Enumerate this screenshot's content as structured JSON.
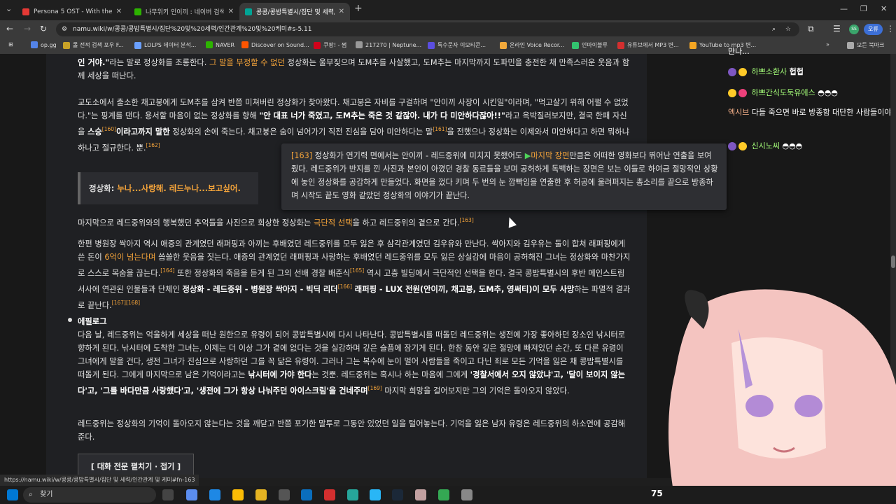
{
  "tabs": [
    {
      "label": "Persona 5 OST - With the",
      "color": "#e53935",
      "active": false
    },
    {
      "label": "나무위키 인이끼 : 네이버 검색",
      "color": "#2db400",
      "active": false
    },
    {
      "label": "콩콩/콩밥특별시/집단 및 세력/",
      "color": "#00a495",
      "active": true
    }
  ],
  "address": {
    "url": "namu.wiki/w/콩콩/콩밥특별시/집단%20및%20세력/인간관계%20및%20케미#s-5.11"
  },
  "profile": {
    "label": "오류"
  },
  "bookmarks": [
    {
      "label": "op.gg",
      "color": "#5383e8"
    },
    {
      "label": "롤 전적 검색 포우 F...",
      "color": "#c9a227"
    },
    {
      "label": "LOLPS 데이터 분석...",
      "color": "#6aa0ff"
    },
    {
      "label": "NAVER",
      "color": "#2db400"
    },
    {
      "label": "Discover on Sound...",
      "color": "#ff5500"
    },
    {
      "label": "쿠팡! - 쩜",
      "color": "#d0021b"
    },
    {
      "label": "217270 | Neptune...",
      "color": "#999999"
    },
    {
      "label": "특수문자 이모티콘...",
      "color": "#5b4ee0"
    },
    {
      "label": "온라인 Voice Recor...",
      "color": "#f2a93b"
    },
    {
      "label": "인마이블루",
      "color": "#33c36f"
    },
    {
      "label": "유튜브에서 MP3 변...",
      "color": "#d32f2f"
    },
    {
      "label": "YouTube to mp3 변...",
      "color": "#f5a623"
    },
    {
      "label": "모든 북마크",
      "color": "#aaaaaa"
    }
  ],
  "article": {
    "p1_a": "인 거야.\"",
    "p1_b": "라는 말로 정상화를 조롱한다. ",
    "p1_link": "그 말을 부정할 수 없던",
    "p1_c": " 정상화는 울부짖으며 도M추를 사살했고, 도M추는 마지막까지 도파민을 충전한 채 만족스러운 웃음과 함께 세상을 떠난다.",
    "p2_a": "교도소에서 출소한 채고붕에게 도M추를 삼켜 반쯤 미쳐버린 정상화가 찾아왔다. 채고붕은 자비를 구걸하며 \"안이끼 사장이 시킨일\"이라며, \"먹고살기 위해 어쩔 수 없었다.\"는 핑계를 댄다. 용서할 마음이 없는 정상화를 향해 ",
    "p2_b": "\"안 대표 너가 죽였고, 도M추는 죽은 것 같잖아. 내가 다 미안하다잖아!!\"",
    "p2_c": "라고 윽박질러보지만, 결국 한패 자신을 ",
    "p2_d": "스승",
    "p2_ref160": "[160]",
    "p2_e": "이라고까지 말한",
    "p2_f": " 정상화의 손에 죽는다. 채고붕은 숨이 넘어가기 직전 진심을 담아 미안하다는 말",
    "p2_ref161": "[161]",
    "p2_g": "을 전했으나 정상화는 이제와서 미안하다고 하면 뭐하냐 하나고 절규한다.",
    "p2_h": "뿐.",
    "p2_ref162": "[162]",
    "quote_a": "정상화: ",
    "quote_b": "누나...사랑해. 레드누나...보고싶어.",
    "p3_a": "마지막으로 레드중위와의 행복했던 추억들을 사진으로 회상한 정상화는 ",
    "p3_link": "극단적 선택",
    "p3_b": "을 하고 레드중위의 곁으로 간다.",
    "p3_ref": "[163]",
    "p4_a": "한편 병원장 싹아지 역시 애증의 관계였던 래퍼핑과 아끼는 후배였던 레드중위를 모두 잃은 후 삼각관계였던 김우유와 만난다. 싹아지와 김우유는 둘이 합쳐 래퍼핑에게 쓴 돈이 ",
    "p4_link": "6억이 넘는다며",
    "p4_b": " 씁쓸한 웃음을 짓는다. 애증의 관계였던 래퍼핑과 사랑하는 후배였던 레드중위를 모두 잃은 상실감에 마음이 공허해진 그녀는 정상화와 마찬가지로 스스로 목숨을 끊는다.",
    "p4_ref164": "[164]",
    "p4_c": " 또한 정상화의 죽음을 듣게 된 그의 선배 경찰 배준식",
    "p4_ref165": "[165]",
    "p4_d": " 역시 고층 빌딩에서 극단적인 선택을 한다. 결국 콩밥특별시의 후반 메인스트림 서사에 연관된 인물들과 단체인 ",
    "p4_e": "정상화 - 레드중위 - 병원장 싹아지 - 빅딕 리더",
    "p4_ref166": "[166]",
    "p4_f": " 래퍼핑 - LUX 전원(안이끼, 채고붕, 도M추, 영써티)이 모두 사망",
    "p4_g": "하는 파멸적 결과로 끝난다.",
    "p4_ref167": "[167]",
    "p4_ref168": "[168]",
    "epi_title": "에필로그",
    "epi_a": "다음 날, 레드중위는 억울하게 세상을 떠난 원한으로 유령이 되어 콩밥특별시에 다시 나타난다. 콩밥특별시를 떠돌던 레드중위는 생전에 가장 좋아하던 장소인 낚시터로 향하게 된다. 낚시터에 도착한 그녀는, 이제는 더 이상 그가 곁에 없다는 것을 실감하며 깊은 슬픔에 잠기게 된다. 한참 동안 깊은 절망에 빠져있던 순간, 또 다른 유령이 그녀에게 말을 건다, 생전 그녀가 진심으로 사랑하던 그를 꼭 닮은 유령이. 그러나 그는 복수에 눈이 멀어 사람들을 죽이고 다닌 죄로 모든 기억을 잃은 채 콩밥특별시를 떠돌게 된다. 그에게 마지막으로 남은 기억이라고는 ",
    "epi_b": "낚시터에 가야 한다",
    "epi_c": "는 것뿐. 레드중위는 혹시나 하는 마음에 그에게 ",
    "epi_d": "'경찰서에서 오지 않았냐'고, '달이 보이지 않는다'고, '그를 바다만큼 사랑했다'고, '생전에 그가 항상 나눠주던 아이스크림'을 건네주며",
    "epi_ref169": "[169]",
    "epi_e": " 마지막 희망을 걸어보지만 그의 기억은 돌아오지 않았다.",
    "p5": "레드중위는 정상화의 기억이 돌아오지 않는다는 것을 깨닫고 반쯤 포기한 말투로 그동안 있었던 일을 털어놓는다. 기억을 잃은 남자 유령은 레드중위의 하소연에 공감해준다.",
    "fold_button": "[ 대화 전문 펼치기 · 접기 ]"
  },
  "tooltip": {
    "ref": "[163]",
    "a": " 정상화가 연기력 면에서는 안이끼 - 레드중위에 미치지 못했어도 ",
    "link": "마지막 장면",
    "b": "만큼은 어떠한 영화보다 뛰어난 연출을 보여줬다. 레드중위가 반지를 낀 사진과 본인이 아꼈던 경찰 동료들을 보며 공허하게 독백하는 장면은 보는 이들로 하여금 절망적인 상황에 놓인 정상화를 공감하게 만들었다. 화면을 껐다 키며 두 번의 눈 깜빡임을 연출한 후 허공에 울려퍼지는 총소리를 끝으로 방종하며 시작도 끝도 영화 같았던 정상화의 이야기가 끝난다."
  },
  "chat": [
    {
      "name": "",
      "text": "만나..."
    },
    {
      "name": "하쁘소환사",
      "text": "헙헙"
    },
    {
      "name": "하쁘간식도둑유에스",
      "text": "◓◓◓"
    },
    {
      "name": "엑시브",
      "text": "다들 죽으면 바로 방종함 대단한 사람들이야"
    },
    {
      "name": "신시노씨",
      "text": "◓◓◓"
    }
  ],
  "status_url": "https://namu.wiki/w/콩콩/콩밥특별시/집단 및 세력/인간관계 및 케미#fn-163",
  "taskbar": {
    "search_label": "찾기",
    "viewers": "75"
  }
}
